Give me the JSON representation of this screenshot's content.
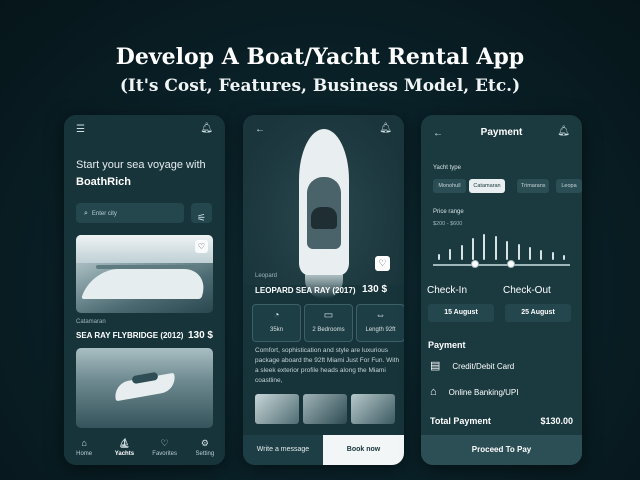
{
  "headline": {
    "title": "Develop A Boat/Yacht Rental App",
    "subtitle": "(It's Cost, Features, Business Model, Etc.)"
  },
  "home": {
    "greeting": "Start your sea voyage with",
    "brand": "BoathRich",
    "search_placeholder": "Enter city",
    "listing_category": "Catamaran",
    "listing_name": "SEA RAY FLYBRIDGE (2012)",
    "listing_price": "130 $",
    "nav": [
      {
        "label": "Home",
        "icon": "home-icon"
      },
      {
        "label": "Yachts",
        "icon": "boat-icon"
      },
      {
        "label": "Favorites",
        "icon": "heart-icon"
      },
      {
        "label": "Setting",
        "icon": "gear-icon"
      }
    ]
  },
  "detail": {
    "category": "Leopard",
    "name": "LEOPARD SEA RAY (2017)",
    "price": "130 $",
    "specs": [
      {
        "value": "35kn",
        "icon": "speed-icon"
      },
      {
        "value": "2 Bedrooms",
        "icon": "bed-icon"
      },
      {
        "value": "Length 92ft",
        "icon": "ruler-icon"
      }
    ],
    "description": "Comfort, sophistication and style are luxurious package aboard the 92ft Miami Just For Fun. With a sleek exterior profile heads along the Miami coastline,",
    "message_label": "Write a message",
    "book_label": "Book now"
  },
  "payment": {
    "title": "Payment",
    "yacht_type_label": "Yacht type",
    "yacht_types": [
      "Monohull",
      "Catamaran",
      "Trimarans",
      "Leopa"
    ],
    "selected_type": "Catamaran",
    "price_range_label": "Price range",
    "price_range_value": "$200 - $600",
    "histogram": [
      6,
      10,
      14,
      20,
      24,
      22,
      18,
      15,
      12,
      9,
      7,
      5
    ],
    "check_in_label": "Check-In",
    "check_out_label": "Check-Out",
    "check_in_date": "15 August",
    "check_out_date": "25 August",
    "payment_label": "Payment",
    "options": [
      {
        "label": "Credit/Debit Card",
        "icon": "card-icon"
      },
      {
        "label": "Online Banking/UPI",
        "icon": "bank-icon"
      }
    ],
    "total_label": "Total Payment",
    "total_value": "$130.00",
    "proceed_label": "Proceed To Pay"
  },
  "colors": {
    "background": "#0a2229",
    "phone": "#17343b",
    "accent_light": "#f2f6f7"
  }
}
